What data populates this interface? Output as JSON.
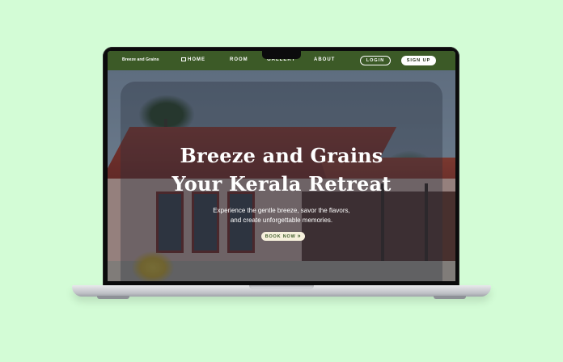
{
  "nav": {
    "logo": "Breeze and Grains",
    "home": "HOME",
    "room": "ROOM",
    "gallery": "GALLERY",
    "about": "ABOUT",
    "login": "LOGIN",
    "signup": "SIGN UP"
  },
  "hero": {
    "title_line1": "Breeze and Grains",
    "title_line2": "Your Kerala Retreat",
    "subtitle_line1": "Experience the gentle breeze, savor the flavors,",
    "subtitle_line2": "and create unforgettable memories.",
    "book_now": "BOOK NOW",
    "book_icon": "double-chevron-right"
  },
  "colors": {
    "background": "#d3fcd6",
    "nav": "#3c5a27",
    "button_light": "#f6f0dc"
  }
}
